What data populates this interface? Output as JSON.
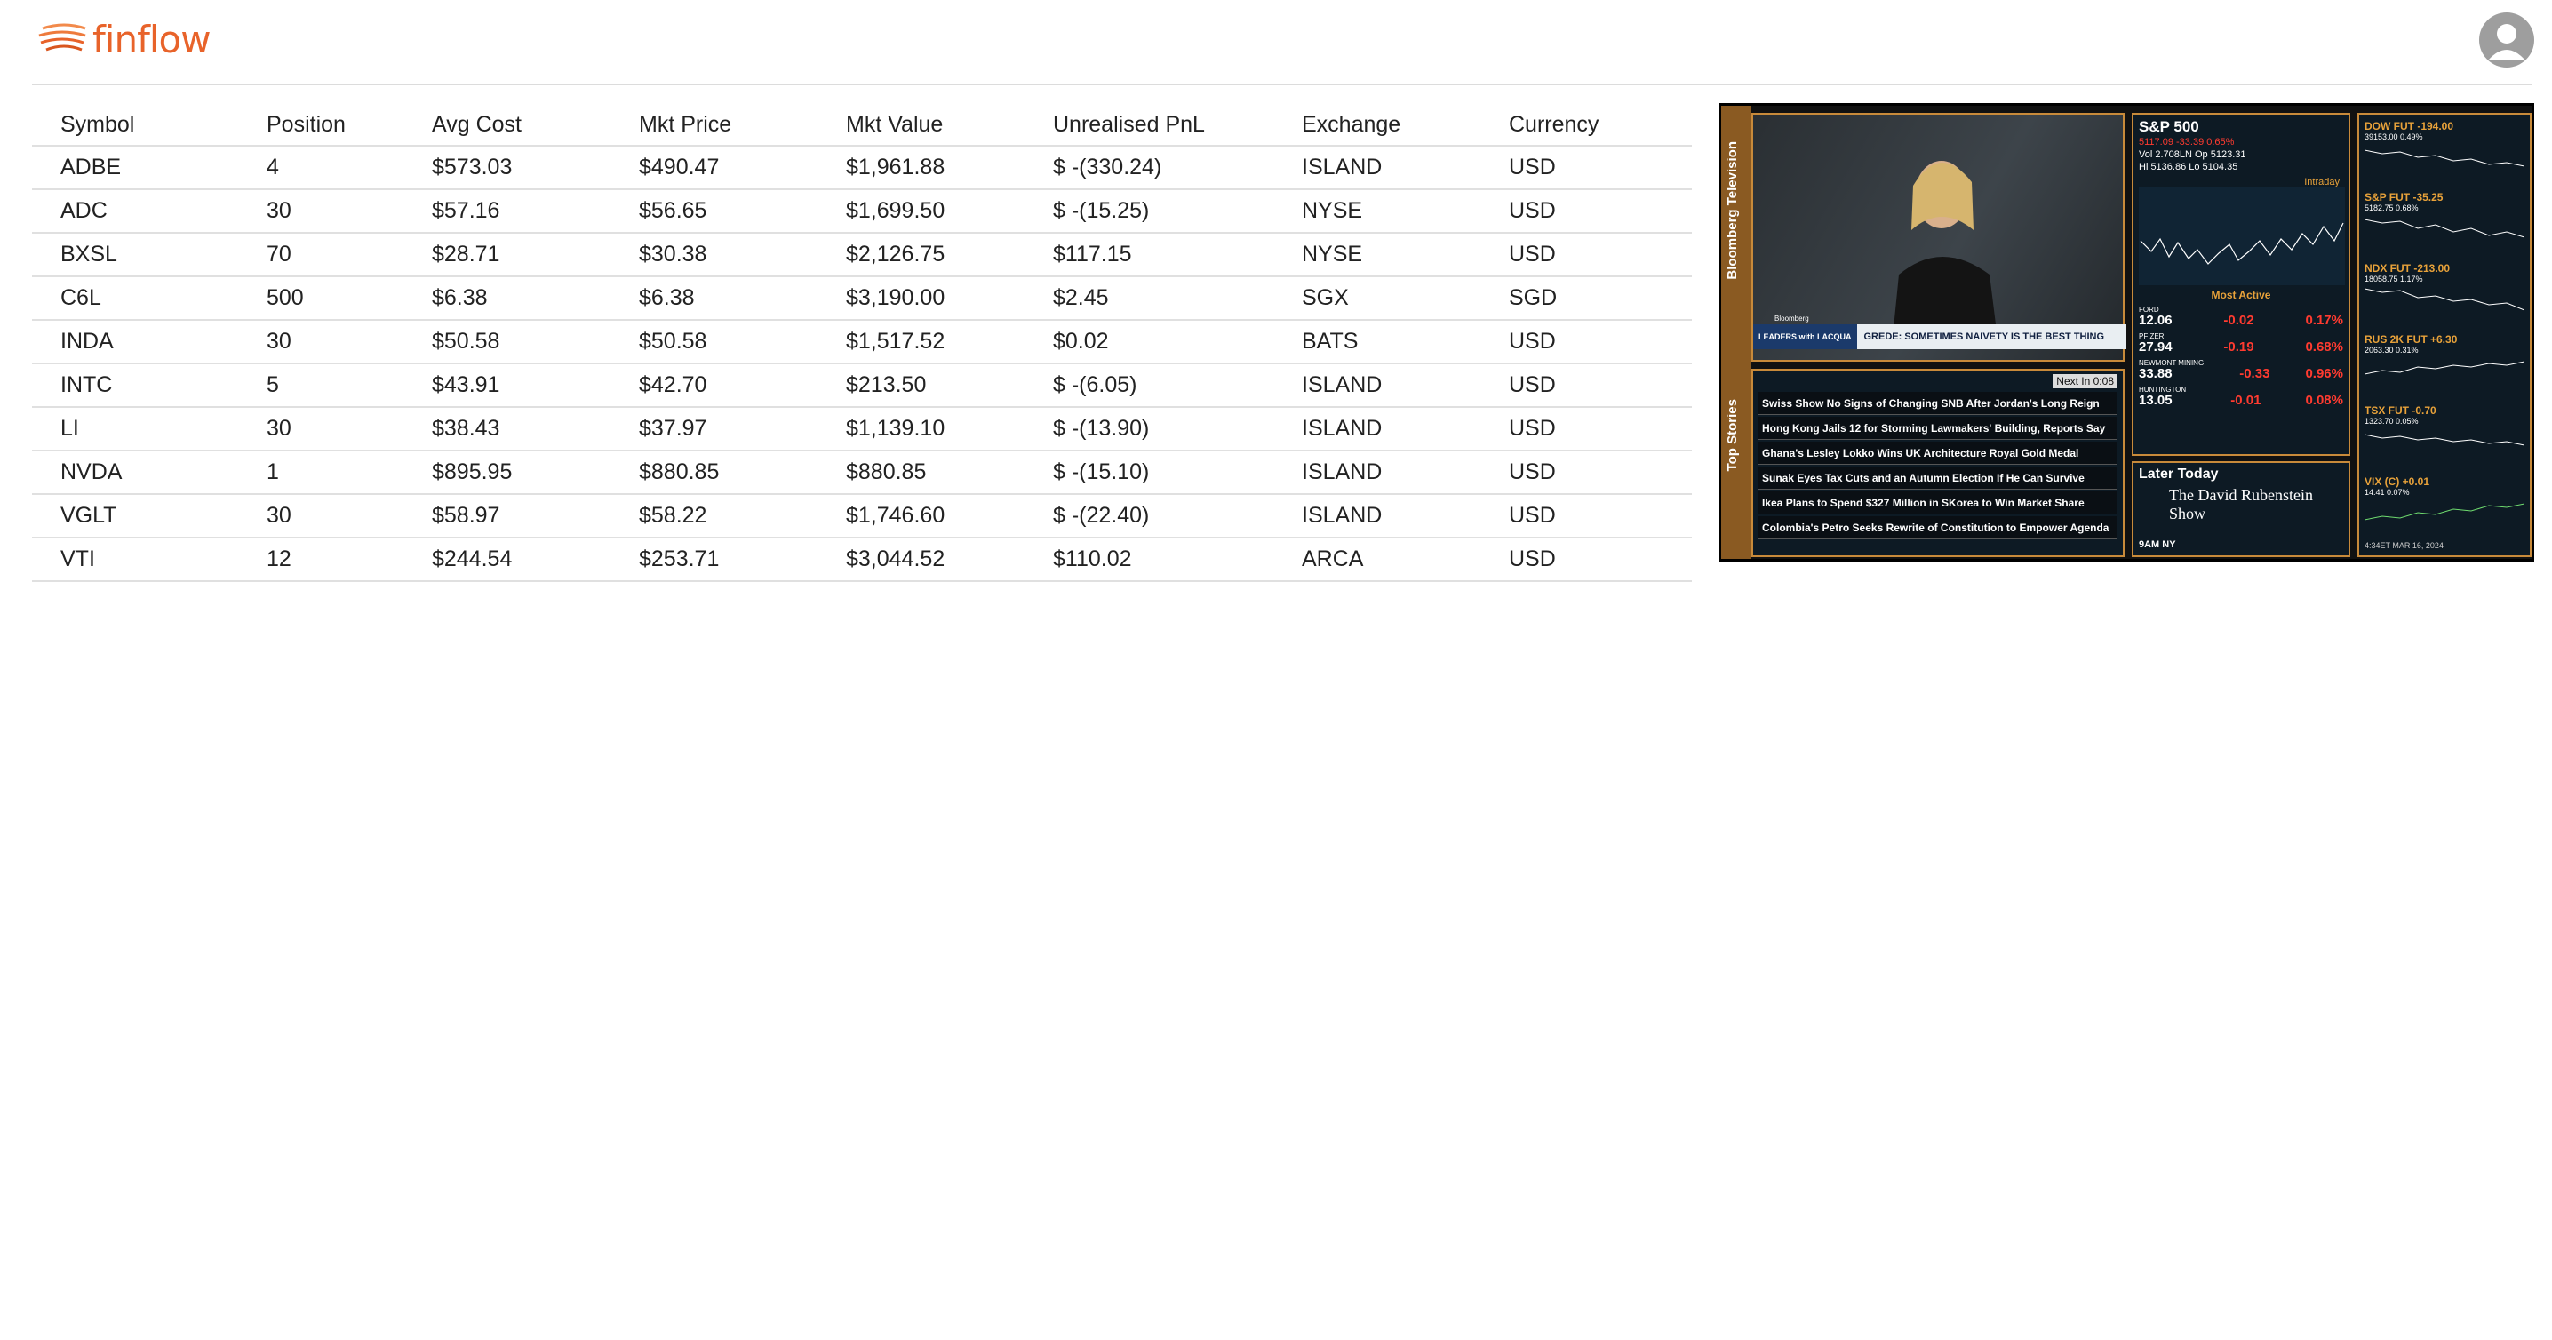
{
  "app": {
    "logo_text": "finflow",
    "accent": "#e8632a"
  },
  "table": {
    "headers": [
      "Symbol",
      "Position",
      "Avg Cost",
      "Mkt Price",
      "Mkt Value",
      "Unrealised PnL",
      "Exchange",
      "Currency"
    ],
    "rows": [
      {
        "symbol": "ADBE",
        "position": "4",
        "avg_cost": "$573.03",
        "mkt_price": "$490.47",
        "mkt_value": "$1,961.88",
        "pnl": "$ -(330.24)",
        "pnl_sign": "neg",
        "exchange": "ISLAND",
        "currency": "USD"
      },
      {
        "symbol": "ADC",
        "position": "30",
        "avg_cost": "$57.16",
        "mkt_price": "$56.65",
        "mkt_value": "$1,699.50",
        "pnl": "$ -(15.25)",
        "pnl_sign": "neg",
        "exchange": "NYSE",
        "currency": "USD"
      },
      {
        "symbol": "BXSL",
        "position": "70",
        "avg_cost": "$28.71",
        "mkt_price": "$30.38",
        "mkt_value": "$2,126.75",
        "pnl": "$117.15",
        "pnl_sign": "pos",
        "exchange": "NYSE",
        "currency": "USD"
      },
      {
        "symbol": "C6L",
        "position": "500",
        "avg_cost": "$6.38",
        "mkt_price": "$6.38",
        "mkt_value": "$3,190.00",
        "pnl": "$2.45",
        "pnl_sign": "pos",
        "exchange": "SGX",
        "currency": "SGD"
      },
      {
        "symbol": "INDA",
        "position": "30",
        "avg_cost": "$50.58",
        "mkt_price": "$50.58",
        "mkt_value": "$1,517.52",
        "pnl": "$0.02",
        "pnl_sign": "pos",
        "exchange": "BATS",
        "currency": "USD"
      },
      {
        "symbol": "INTC",
        "position": "5",
        "avg_cost": "$43.91",
        "mkt_price": "$42.70",
        "mkt_value": "$213.50",
        "pnl": "$ -(6.05)",
        "pnl_sign": "neg",
        "exchange": "ISLAND",
        "currency": "USD"
      },
      {
        "symbol": "LI",
        "position": "30",
        "avg_cost": "$38.43",
        "mkt_price": "$37.97",
        "mkt_value": "$1,139.10",
        "pnl": "$ -(13.90)",
        "pnl_sign": "neg",
        "exchange": "ISLAND",
        "currency": "USD"
      },
      {
        "symbol": "NVDA",
        "position": "1",
        "avg_cost": "$895.95",
        "mkt_price": "$880.85",
        "mkt_value": "$880.85",
        "pnl": "$ -(15.10)",
        "pnl_sign": "neg",
        "exchange": "ISLAND",
        "currency": "USD"
      },
      {
        "symbol": "VGLT",
        "position": "30",
        "avg_cost": "$58.97",
        "mkt_price": "$58.22",
        "mkt_value": "$1,746.60",
        "pnl": "$ -(22.40)",
        "pnl_sign": "neg",
        "exchange": "ISLAND",
        "currency": "USD"
      },
      {
        "symbol": "VTI",
        "position": "12",
        "avg_cost": "$244.54",
        "mkt_price": "$253.71",
        "mkt_value": "$3,044.52",
        "pnl": "$110.02",
        "pnl_sign": "pos",
        "exchange": "ARCA",
        "currency": "USD"
      }
    ]
  },
  "tv": {
    "channel_label": "Bloomberg Television",
    "stories_label": "Top Stories",
    "lower_third_brand": "LEADERS with LACQUA",
    "lower_third_small": "Bloomberg",
    "lower_third_text": "GREDE: SOMETIMES NAIVETY IS THE BEST THING",
    "sp": {
      "title": "S&P 500",
      "line1": "5117.09 -33.39 0.65%",
      "line2": "Vol 2.708LN Op 5123.31",
      "line3": "Hi 5136.86 Lo 5104.35",
      "intraday": "Intraday",
      "most_active": "Most Active",
      "active": [
        {
          "name": "FORD",
          "price": "12.06",
          "chg": "-0.02",
          "pct": "0.17%"
        },
        {
          "name": "PFIZER",
          "price": "27.94",
          "chg": "-0.19",
          "pct": "0.68%"
        },
        {
          "name": "NEWMONT MINING",
          "price": "33.88",
          "chg": "-0.33",
          "pct": "0.96%"
        },
        {
          "name": "HUNTINGTON",
          "price": "13.05",
          "chg": "-0.01",
          "pct": "0.08%"
        }
      ]
    },
    "futures": [
      {
        "name": "DOW FUT -194.00",
        "val": "39153.00 0.49%"
      },
      {
        "name": "S&P FUT -35.25",
        "val": "5182.75 0.68%"
      },
      {
        "name": "NDX FUT -213.00",
        "val": "18058.75 1.17%"
      },
      {
        "name": "RUS 2K FUT +6.30",
        "val": "2063.30 0.31%"
      },
      {
        "name": "TSX FUT -0.70",
        "val": "1323.70 0.05%"
      },
      {
        "name": "VIX (C) +0.01",
        "val": "14.41 0.07%"
      }
    ],
    "time": "4:34ET  MAR 16, 2024",
    "next_in": "Next In 0:08",
    "stories": [
      "Swiss Show No Signs of Changing SNB After Jordan's Long Reign",
      "Hong Kong Jails 12 for Storming Lawmakers' Building, Reports Say",
      "Ghana's Lesley Lokko Wins UK Architecture Royal Gold Medal",
      "Sunak Eyes Tax Cuts and an Autumn Election  If He Can Survive",
      "Ikea Plans to Spend $327 Million in SKorea to Win Market Share",
      "Colombia's Petro Seeks Rewrite of Constitution to Empower Agenda"
    ],
    "later_today": "Later Today",
    "later_show": "The David Rubenstein Show",
    "later_time": "9AM NY"
  }
}
